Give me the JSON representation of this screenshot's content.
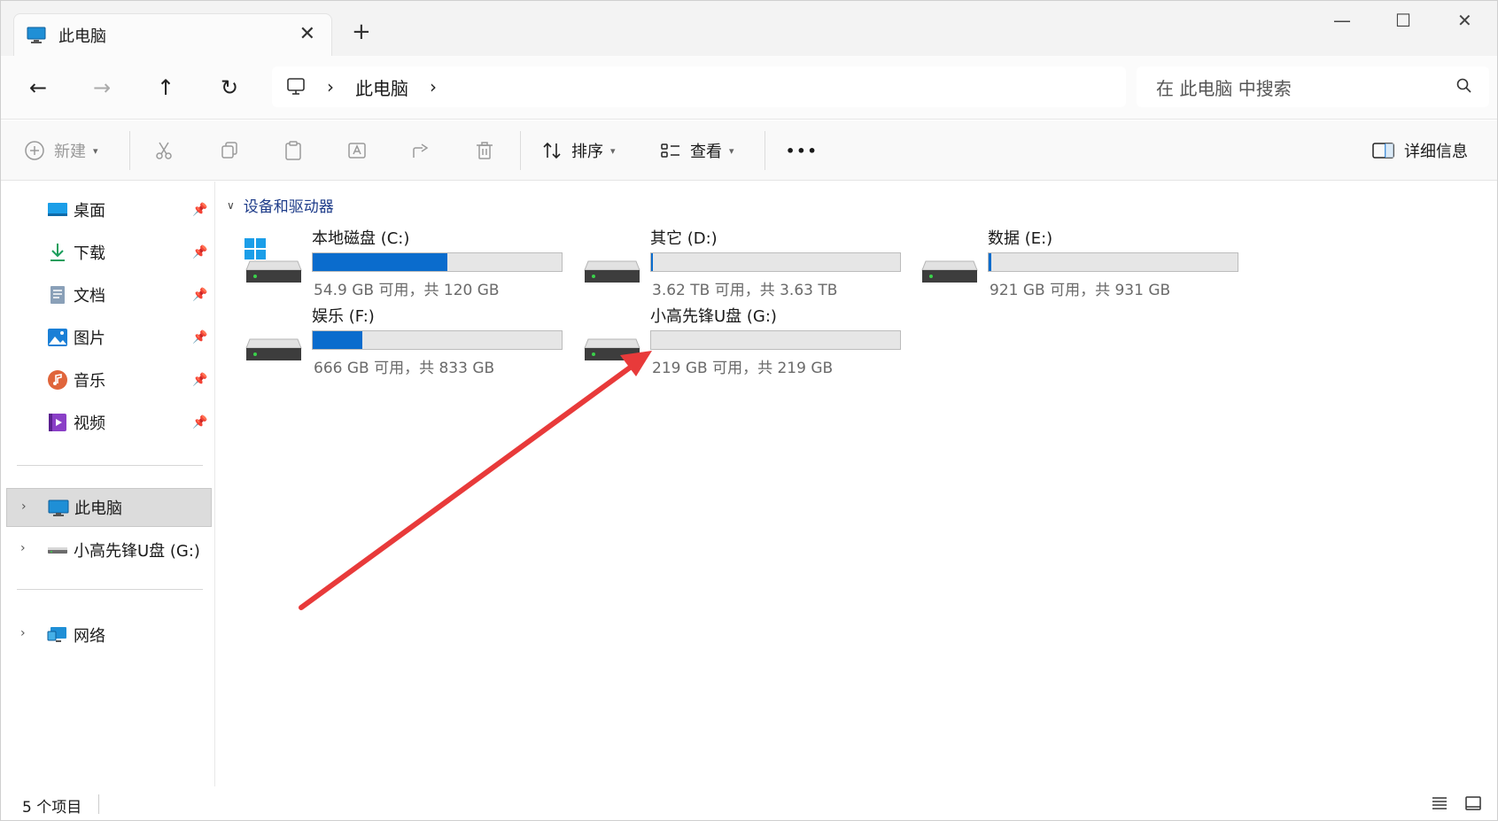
{
  "tab": {
    "title": "此电脑",
    "close": "✕",
    "new_tab": "+"
  },
  "window_controls": {
    "minimize": "—",
    "maximize": "☐",
    "close": "✕"
  },
  "nav": {
    "back": "←",
    "forward": "→",
    "up": "↑",
    "refresh": "↻"
  },
  "address": {
    "crumbs": [
      "此电脑"
    ],
    "sep": "›"
  },
  "search": {
    "placeholder": "在 此电脑 中搜索"
  },
  "commands": {
    "new": "新建",
    "sort": "排序",
    "view": "查看",
    "more": "•••",
    "details": "详细信息"
  },
  "sidebar": {
    "quick": [
      {
        "label": "桌面",
        "icon": "desktop-icon"
      },
      {
        "label": "下载",
        "icon": "download-icon"
      },
      {
        "label": "文档",
        "icon": "document-icon"
      },
      {
        "label": "图片",
        "icon": "pictures-icon"
      },
      {
        "label": "音乐",
        "icon": "music-icon"
      },
      {
        "label": "视频",
        "icon": "video-icon"
      }
    ],
    "this_pc": "此电脑",
    "usb": "小高先锋U盘 (G:)",
    "network": "网络"
  },
  "content": {
    "group_header": "设备和驱动器",
    "drives": [
      {
        "name": "本地磁盘 (C:)",
        "free": "54.9 GB 可用，共 120 GB",
        "used_fraction": 0.54,
        "system": true
      },
      {
        "name": "其它 (D:)",
        "free": "3.62 TB 可用，共 3.63 TB",
        "used_fraction": 0.003,
        "system": false
      },
      {
        "name": "数据 (E:)",
        "free": "921 GB 可用，共 931 GB",
        "used_fraction": 0.011,
        "system": false
      },
      {
        "name": "娱乐 (F:)",
        "free": "666 GB 可用，共 833 GB",
        "used_fraction": 0.2,
        "system": false
      },
      {
        "name": "小高先锋U盘 (G:)",
        "free": "219 GB 可用，共 219 GB",
        "used_fraction": 0.0,
        "system": false
      }
    ]
  },
  "status": {
    "item_count": "5 个项目"
  },
  "colors": {
    "accent": "#0a6ccd",
    "annotation_arrow": "#e83a3a"
  }
}
